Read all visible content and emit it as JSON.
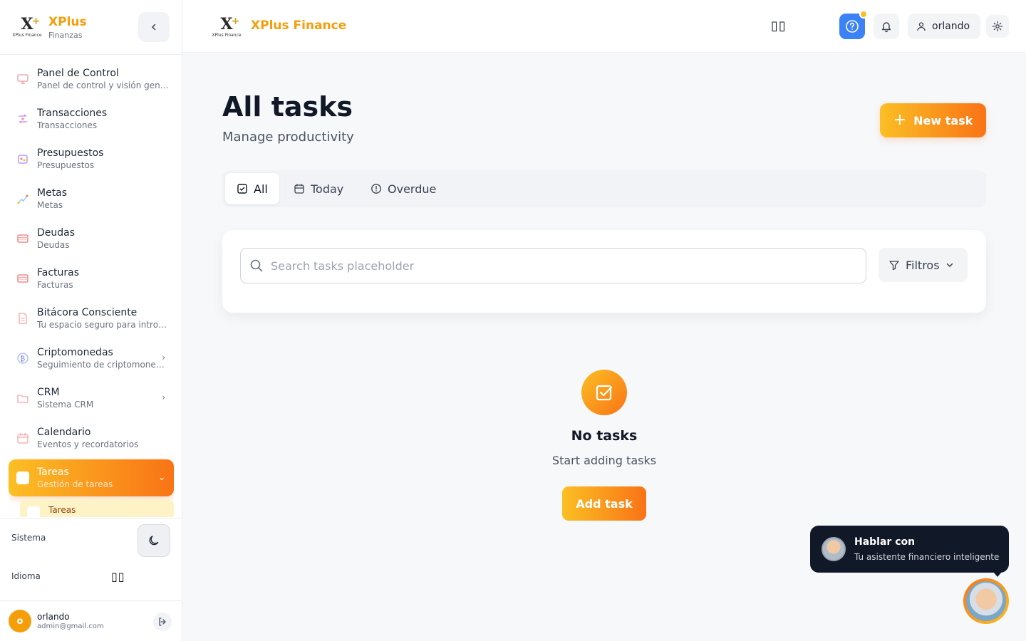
{
  "brand": {
    "name": "XPlus",
    "subtitle": "Finanzas",
    "logo_text": "XPlus Finance",
    "header_name": "XPlus Finance"
  },
  "sidebar": {
    "items": [
      {
        "label": "Panel de Control",
        "desc": "Panel de control y visión general",
        "icon": "monitor-icon",
        "has_chevron": false
      },
      {
        "label": "Transacciones",
        "desc": "Transacciones",
        "icon": "transactions-icon",
        "has_chevron": false
      },
      {
        "label": "Presupuestos",
        "desc": "Presupuestos",
        "icon": "budget-icon",
        "has_chevron": false
      },
      {
        "label": "Metas",
        "desc": "Metas",
        "icon": "goal-chart-icon",
        "has_chevron": false
      },
      {
        "label": "Deudas",
        "desc": "Deudas",
        "icon": "credit-card-icon",
        "has_chevron": false
      },
      {
        "label": "Facturas",
        "desc": "Facturas",
        "icon": "invoice-card-icon",
        "has_chevron": false
      },
      {
        "label": "Bitácora Consciente",
        "desc": "Tu espacio seguro para introspección",
        "icon": "journal-icon",
        "has_chevron": false
      },
      {
        "label": "Criptomonedas",
        "desc": "Seguimiento de criptomonedas",
        "icon": "crypto-coin-icon",
        "has_chevron": true
      },
      {
        "label": "CRM",
        "desc": "Sistema CRM",
        "icon": "folder-icon",
        "has_chevron": true
      },
      {
        "label": "Calendario",
        "desc": "Eventos y recordatorios",
        "icon": "calendar-icon",
        "has_chevron": false
      },
      {
        "label": "Tareas",
        "desc": "Gestión de tareas",
        "icon": "tasks-icon",
        "has_chevron": true,
        "active": true
      }
    ],
    "sub_item": "Tareas",
    "system_label": "Sistema",
    "language_label": "Idioma",
    "language_flag": "▯▯"
  },
  "user": {
    "initial": "o",
    "name": "orlando",
    "email": "admin@gmail.com"
  },
  "header": {
    "language_flag": "▯▯",
    "username": "orlando"
  },
  "main": {
    "title": "All tasks",
    "subtitle": "Manage productivity",
    "new_task_label": "New task",
    "tabs": [
      {
        "label": "All",
        "icon": "check-square-icon"
      },
      {
        "label": "Today",
        "icon": "calendar-icon"
      },
      {
        "label": "Overdue",
        "icon": "alert-circle-icon"
      }
    ],
    "search_placeholder": "Search tasks placeholder",
    "filters_label": "Filtros",
    "empty_title": "No tasks",
    "empty_sub": "Start adding tasks",
    "add_task_label": "Add task"
  },
  "chat": {
    "title": "Hablar con",
    "subtitle": "Tu asistente financiero inteligente"
  },
  "colors": {
    "accent": "#f59e0b",
    "accent_end": "#f97316",
    "help_blue": "#3b82f6",
    "chat_bg": "#111827"
  }
}
